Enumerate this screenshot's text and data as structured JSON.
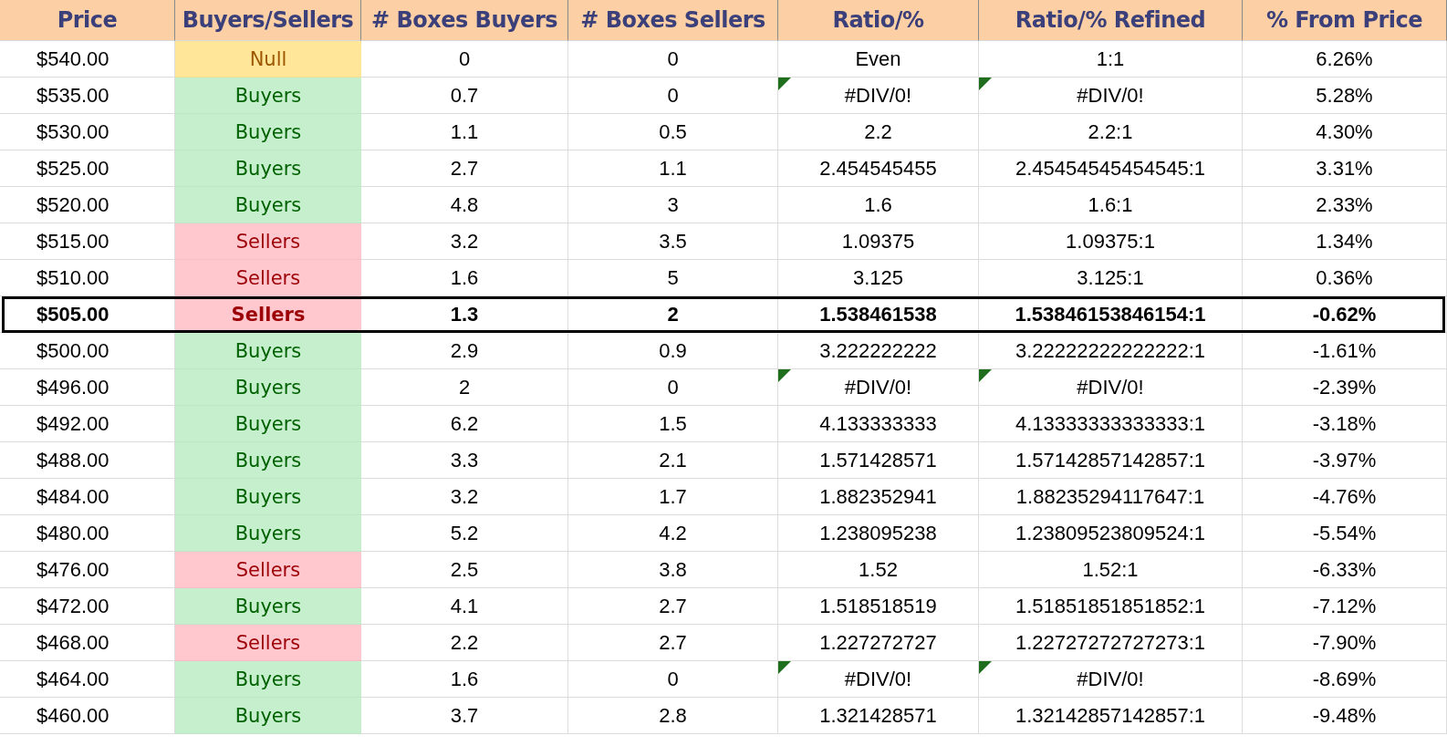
{
  "columns": [
    "Price",
    "Buyers/Sellers",
    "# Boxes Buyers",
    "# Boxes Sellers",
    "Ratio/%",
    "Ratio/% Refined",
    "% From Price"
  ],
  "rows": [
    {
      "price": "$540.00",
      "signal": {
        "label": "Null",
        "kind": "null"
      },
      "buyers": "0",
      "sellers": "0",
      "ratio": {
        "text": "Even",
        "flagged": false
      },
      "refined": {
        "text": "1:1",
        "flagged": false
      },
      "from_price": "6.26%",
      "highlighted": false
    },
    {
      "price": "$535.00",
      "signal": {
        "label": "Buyers",
        "kind": "buyers"
      },
      "buyers": "0.7",
      "sellers": "0",
      "ratio": {
        "text": "#DIV/0!",
        "flagged": true
      },
      "refined": {
        "text": "#DIV/0!",
        "flagged": true
      },
      "from_price": "5.28%",
      "highlighted": false
    },
    {
      "price": "$530.00",
      "signal": {
        "label": "Buyers",
        "kind": "buyers"
      },
      "buyers": "1.1",
      "sellers": "0.5",
      "ratio": {
        "text": "2.2",
        "flagged": false
      },
      "refined": {
        "text": "2.2:1",
        "flagged": false
      },
      "from_price": "4.30%",
      "highlighted": false
    },
    {
      "price": "$525.00",
      "signal": {
        "label": "Buyers",
        "kind": "buyers"
      },
      "buyers": "2.7",
      "sellers": "1.1",
      "ratio": {
        "text": "2.454545455",
        "flagged": false
      },
      "refined": {
        "text": "2.45454545454545:1",
        "flagged": false
      },
      "from_price": "3.31%",
      "highlighted": false
    },
    {
      "price": "$520.00",
      "signal": {
        "label": "Buyers",
        "kind": "buyers"
      },
      "buyers": "4.8",
      "sellers": "3",
      "ratio": {
        "text": "1.6",
        "flagged": false
      },
      "refined": {
        "text": "1.6:1",
        "flagged": false
      },
      "from_price": "2.33%",
      "highlighted": false
    },
    {
      "price": "$515.00",
      "signal": {
        "label": "Sellers",
        "kind": "sellers"
      },
      "buyers": "3.2",
      "sellers": "3.5",
      "ratio": {
        "text": "1.09375",
        "flagged": false
      },
      "refined": {
        "text": "1.09375:1",
        "flagged": false
      },
      "from_price": "1.34%",
      "highlighted": false
    },
    {
      "price": "$510.00",
      "signal": {
        "label": "Sellers",
        "kind": "sellers"
      },
      "buyers": "1.6",
      "sellers": "5",
      "ratio": {
        "text": "3.125",
        "flagged": false
      },
      "refined": {
        "text": "3.125:1",
        "flagged": false
      },
      "from_price": "0.36%",
      "highlighted": false
    },
    {
      "price": "$505.00",
      "signal": {
        "label": "Sellers",
        "kind": "sellers"
      },
      "buyers": "1.3",
      "sellers": "2",
      "ratio": {
        "text": "1.538461538",
        "flagged": false
      },
      "refined": {
        "text": "1.53846153846154:1",
        "flagged": false
      },
      "from_price": "-0.62%",
      "highlighted": true
    },
    {
      "price": "$500.00",
      "signal": {
        "label": "Buyers",
        "kind": "buyers"
      },
      "buyers": "2.9",
      "sellers": "0.9",
      "ratio": {
        "text": "3.222222222",
        "flagged": false
      },
      "refined": {
        "text": "3.22222222222222:1",
        "flagged": false
      },
      "from_price": "-1.61%",
      "highlighted": false
    },
    {
      "price": "$496.00",
      "signal": {
        "label": "Buyers",
        "kind": "buyers"
      },
      "buyers": "2",
      "sellers": "0",
      "ratio": {
        "text": "#DIV/0!",
        "flagged": true
      },
      "refined": {
        "text": "#DIV/0!",
        "flagged": true
      },
      "from_price": "-2.39%",
      "highlighted": false
    },
    {
      "price": "$492.00",
      "signal": {
        "label": "Buyers",
        "kind": "buyers"
      },
      "buyers": "6.2",
      "sellers": "1.5",
      "ratio": {
        "text": "4.133333333",
        "flagged": false
      },
      "refined": {
        "text": "4.13333333333333:1",
        "flagged": false
      },
      "from_price": "-3.18%",
      "highlighted": false
    },
    {
      "price": "$488.00",
      "signal": {
        "label": "Buyers",
        "kind": "buyers"
      },
      "buyers": "3.3",
      "sellers": "2.1",
      "ratio": {
        "text": "1.571428571",
        "flagged": false
      },
      "refined": {
        "text": "1.57142857142857:1",
        "flagged": false
      },
      "from_price": "-3.97%",
      "highlighted": false
    },
    {
      "price": "$484.00",
      "signal": {
        "label": "Buyers",
        "kind": "buyers"
      },
      "buyers": "3.2",
      "sellers": "1.7",
      "ratio": {
        "text": "1.882352941",
        "flagged": false
      },
      "refined": {
        "text": "1.88235294117647:1",
        "flagged": false
      },
      "from_price": "-4.76%",
      "highlighted": false
    },
    {
      "price": "$480.00",
      "signal": {
        "label": "Buyers",
        "kind": "buyers"
      },
      "buyers": "5.2",
      "sellers": "4.2",
      "ratio": {
        "text": "1.238095238",
        "flagged": false
      },
      "refined": {
        "text": "1.23809523809524:1",
        "flagged": false
      },
      "from_price": "-5.54%",
      "highlighted": false
    },
    {
      "price": "$476.00",
      "signal": {
        "label": "Sellers",
        "kind": "sellers"
      },
      "buyers": "2.5",
      "sellers": "3.8",
      "ratio": {
        "text": "1.52",
        "flagged": false
      },
      "refined": {
        "text": "1.52:1",
        "flagged": false
      },
      "from_price": "-6.33%",
      "highlighted": false
    },
    {
      "price": "$472.00",
      "signal": {
        "label": "Buyers",
        "kind": "buyers"
      },
      "buyers": "4.1",
      "sellers": "2.7",
      "ratio": {
        "text": "1.518518519",
        "flagged": false
      },
      "refined": {
        "text": "1.51851851851852:1",
        "flagged": false
      },
      "from_price": "-7.12%",
      "highlighted": false
    },
    {
      "price": "$468.00",
      "signal": {
        "label": "Sellers",
        "kind": "sellers"
      },
      "buyers": "2.2",
      "sellers": "2.7",
      "ratio": {
        "text": "1.227272727",
        "flagged": false
      },
      "refined": {
        "text": "1.22727272727273:1",
        "flagged": false
      },
      "from_price": "-7.90%",
      "highlighted": false
    },
    {
      "price": "$464.00",
      "signal": {
        "label": "Buyers",
        "kind": "buyers"
      },
      "buyers": "1.6",
      "sellers": "0",
      "ratio": {
        "text": "#DIV/0!",
        "flagged": true
      },
      "refined": {
        "text": "#DIV/0!",
        "flagged": true
      },
      "from_price": "-8.69%",
      "highlighted": false
    },
    {
      "price": "$460.00",
      "signal": {
        "label": "Buyers",
        "kind": "buyers"
      },
      "buyers": "3.7",
      "sellers": "2.8",
      "ratio": {
        "text": "1.321428571",
        "flagged": false
      },
      "refined": {
        "text": "1.32142857142857:1",
        "flagged": false
      },
      "from_price": "-9.48%",
      "highlighted": false
    }
  ]
}
